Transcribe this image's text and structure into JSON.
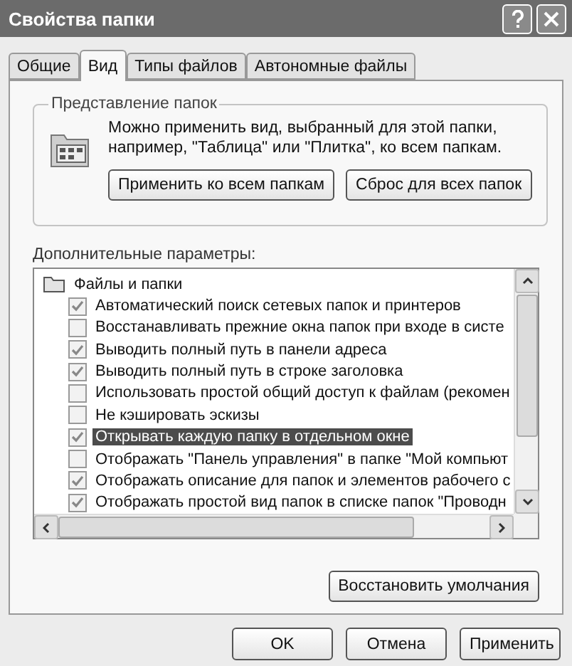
{
  "window": {
    "title": "Свойства папки"
  },
  "tabs": [
    {
      "label": "Общие",
      "selected": false
    },
    {
      "label": "Вид",
      "selected": true
    },
    {
      "label": "Типы файлов",
      "selected": false
    },
    {
      "label": "Автономные файлы",
      "selected": false
    }
  ],
  "folder_views": {
    "title": "Представление папок",
    "text": "Можно применить вид, выбранный для этой папки, например, \"Таблица\" или \"Плитка\", ко всем папкам.",
    "buttons": [
      "Применить ко всем папкам",
      "Сброс для всех папок"
    ]
  },
  "advanced": {
    "label": "Дополнительные параметры:",
    "tree": [
      {
        "label": "Файлы и папки",
        "children": [
          {
            "label": "Автоматический поиск сетевых папок и принтеров",
            "checked": true,
            "selected": false
          },
          {
            "label": "Восстанавливать прежние окна папок при входе в систе",
            "checked": false,
            "selected": false
          },
          {
            "label": "Выводить полный путь в панели адреса",
            "checked": true,
            "selected": false
          },
          {
            "label": "Выводить полный путь в строке заголовка",
            "checked": true,
            "selected": false
          },
          {
            "label": "Использовать простой общий доступ к файлам (рекомен",
            "checked": false,
            "selected": false
          },
          {
            "label": "Не кэшировать эскизы",
            "checked": false,
            "selected": false
          },
          {
            "label": "Открывать каждую папку в отдельном окне",
            "checked": true,
            "selected": true
          },
          {
            "label": "Отображать \"Панель управления\" в папке \"Мой компьют",
            "checked": false,
            "selected": false
          },
          {
            "label": "Отображать описание для папок и элементов рабочего с",
            "checked": true,
            "selected": false
          },
          {
            "label": "Отображать простой вид папок в списке папок \"Проводн",
            "checked": true,
            "selected": false
          }
        ]
      }
    ],
    "restore_button": "Восстановить умолчания"
  },
  "buttons": [
    "OK",
    "Отмена",
    "Применить"
  ]
}
